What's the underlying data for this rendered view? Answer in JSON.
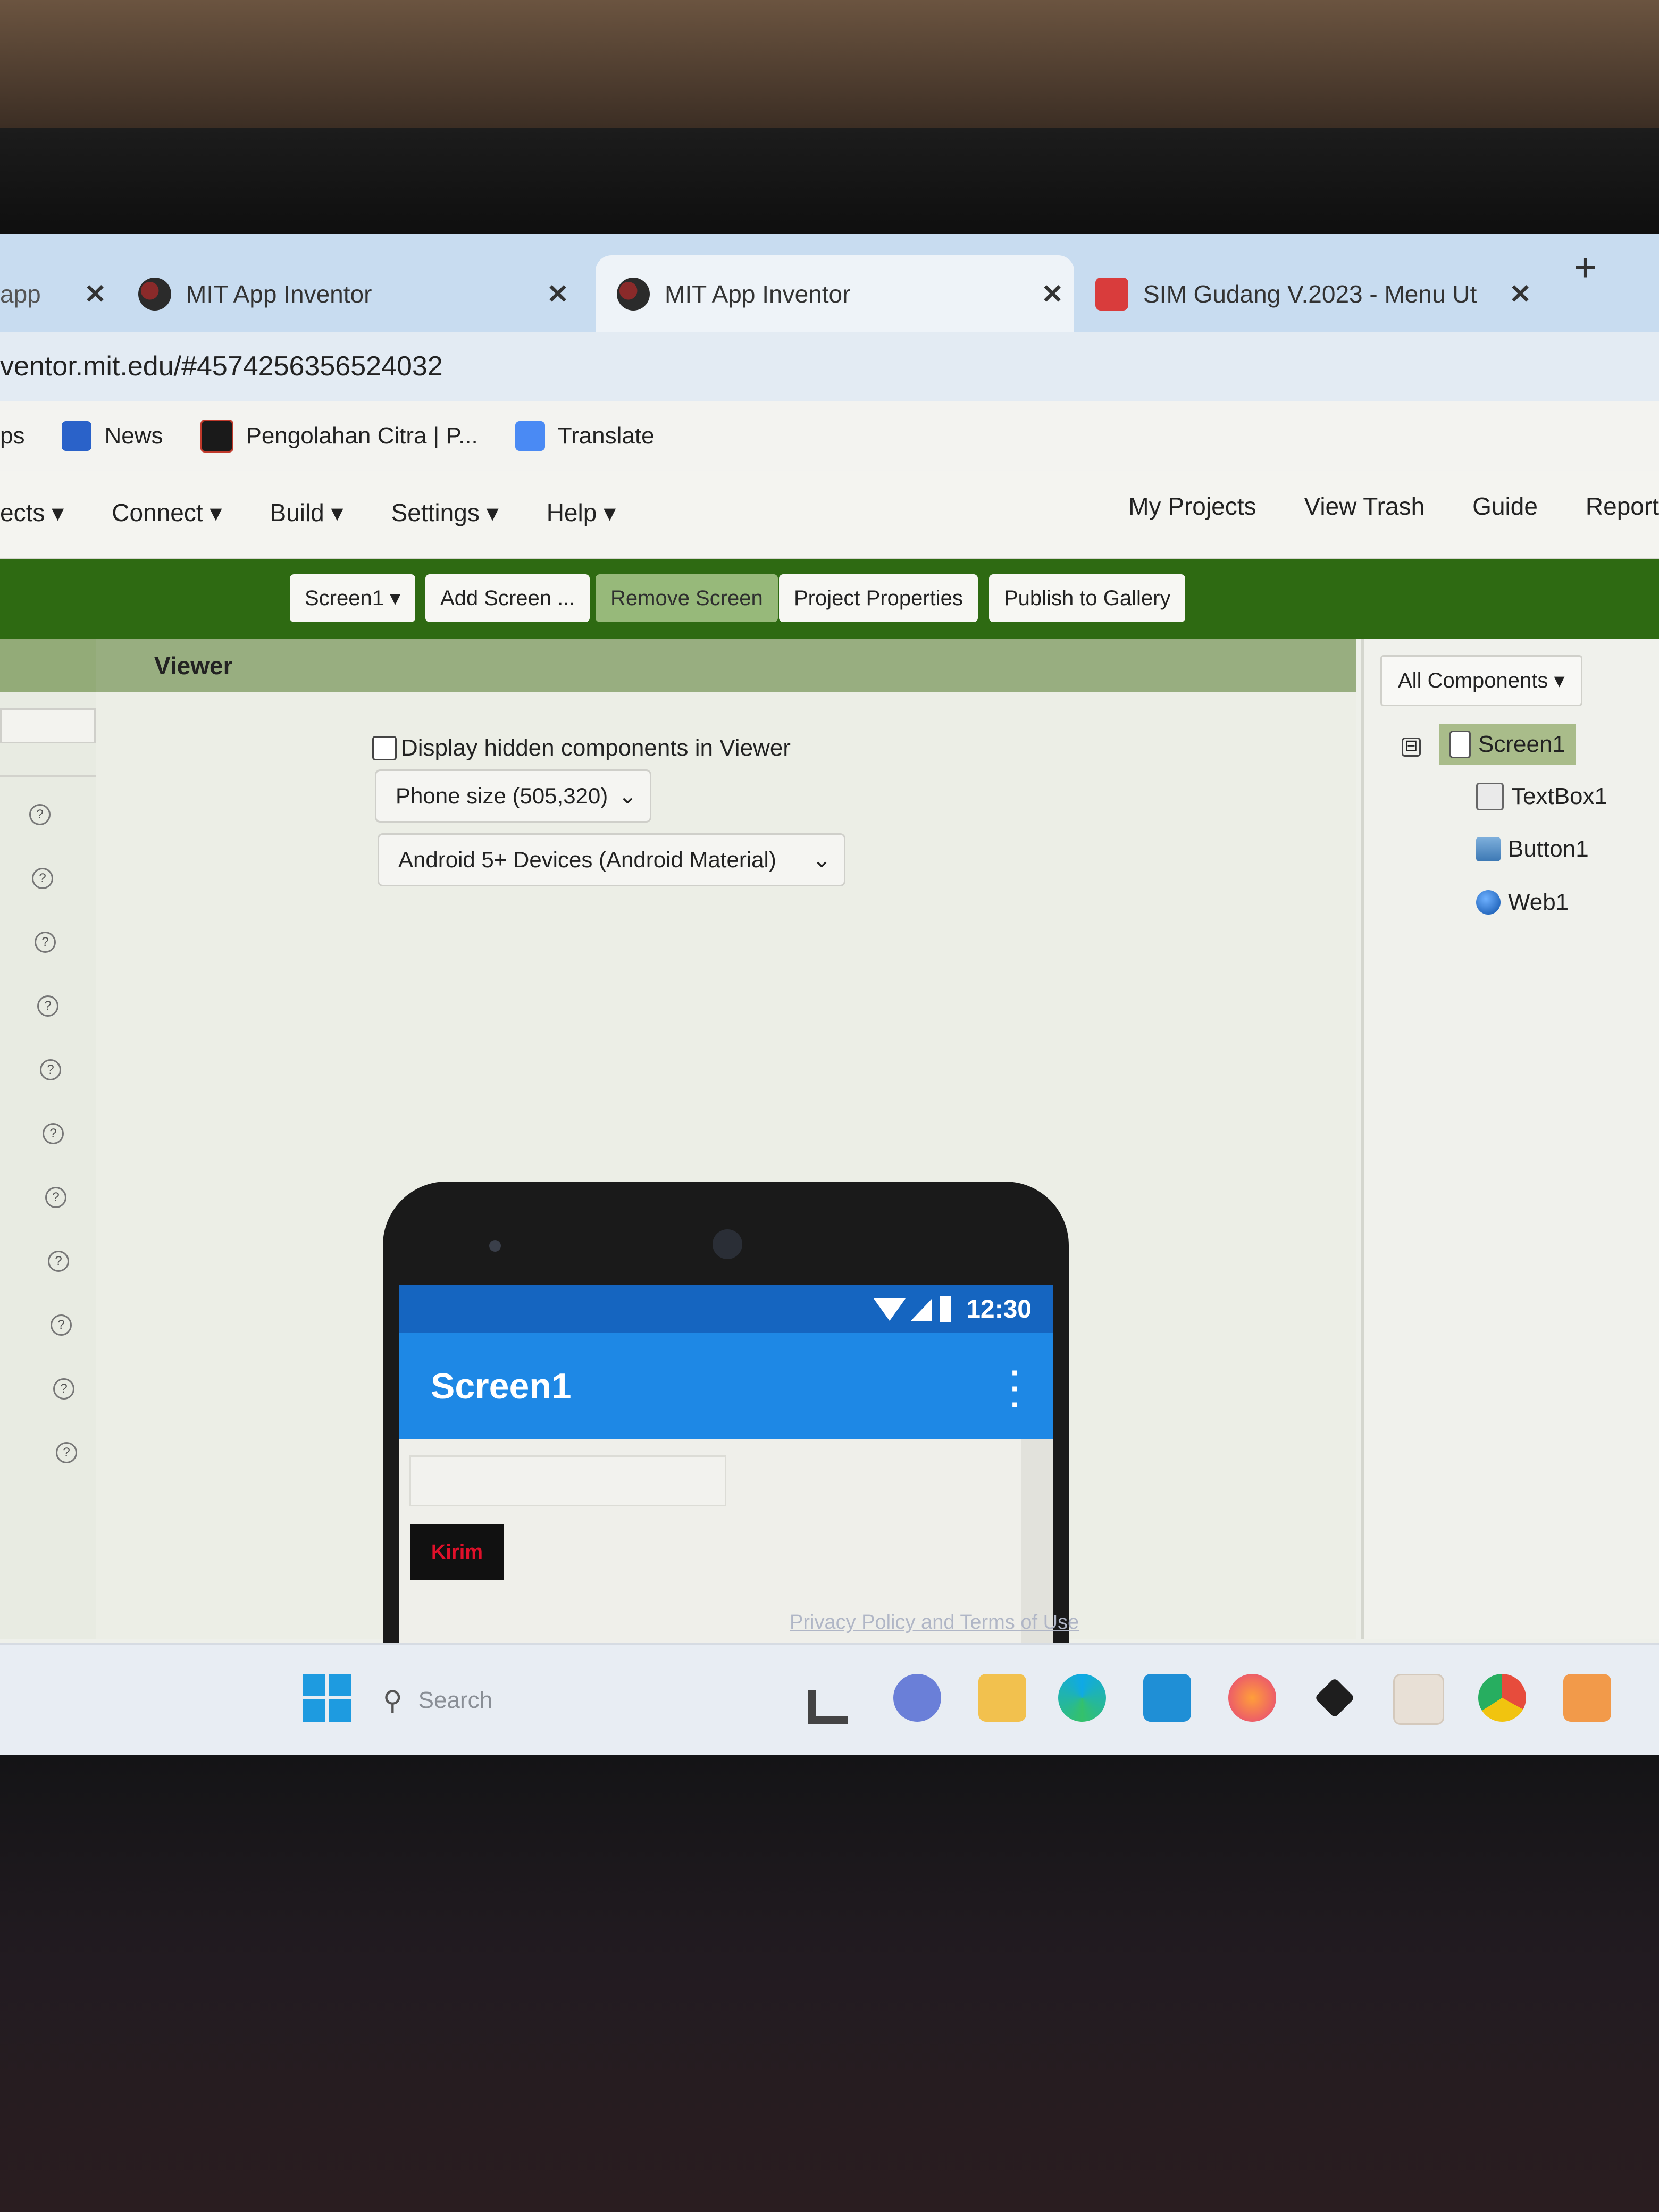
{
  "browser": {
    "tabs": [
      {
        "label": "app",
        "favicon": "app-icon",
        "active": false
      },
      {
        "label": "MIT App Inventor",
        "favicon": "mit-logo-icon",
        "active": false
      },
      {
        "label": "MIT App Inventor",
        "favicon": "mit-logo-icon",
        "active": true
      },
      {
        "label": "SIM Gudang V.2023 - Menu Ut",
        "favicon": "sim-gudang-icon",
        "active": false
      }
    ],
    "new_tab": "+",
    "close_glyph": "✕",
    "url": "ventor.mit.edu/#4574256356524032",
    "bookmarks": [
      {
        "label": "ps",
        "icon": "apps-icon"
      },
      {
        "label": "News",
        "icon": "news-icon"
      },
      {
        "label": "Pengolahan Citra | P...",
        "icon": "pengolahan-icon"
      },
      {
        "label": "Translate",
        "icon": "translate-icon"
      }
    ]
  },
  "appinventor": {
    "menu_left": [
      "ects ▾",
      "Connect ▾",
      "Build ▾",
      "Settings ▾",
      "Help ▾"
    ],
    "menu_right": [
      "My Projects",
      "View Trash",
      "Guide",
      "Report"
    ],
    "toolbar": {
      "screen_select": "Screen1 ▾",
      "add_screen": "Add Screen ...",
      "remove_screen": "Remove Screen",
      "project_properties": "Project Properties",
      "publish": "Publish to Gallery"
    },
    "viewer": {
      "title": "Viewer",
      "hidden_checkbox_label": "Display hidden components in Viewer",
      "phone_size": "Phone size (505,320)",
      "theme": "Android 5+ Devices (Android Material)"
    },
    "phone": {
      "time": "12:30",
      "screen_title": "Screen1",
      "button_label": "Kirim",
      "button_text_color": "#e0102a"
    },
    "components": {
      "filter": "All Components ▾",
      "tree_toggle": "⊟",
      "items": [
        {
          "label": "Screen1",
          "icon": "screen-icon",
          "selected": true
        },
        {
          "label": "TextBox1",
          "icon": "textbox-icon",
          "selected": false
        },
        {
          "label": "Button1",
          "icon": "button-icon",
          "selected": false
        },
        {
          "label": "Web1",
          "icon": "globe-icon",
          "selected": false
        }
      ]
    },
    "help_glyph": "?",
    "footer_link": "Privacy Policy and Terms of Use"
  },
  "taskbar": {
    "search_placeholder": "Search",
    "icons": [
      "windows-start-icon",
      "search-icon",
      "widgets-icon",
      "chat-icon",
      "file-explorer-icon",
      "edge-icon",
      "mail-icon",
      "firefox-icon",
      "dropbox-icon",
      "amazon-icon",
      "chrome-icon",
      "xampp-icon"
    ]
  },
  "colors": {
    "toolbar_green": "#2e6a12",
    "panel_header": "#98ae80",
    "status_bar": "#1565c0",
    "app_bar": "#1e88e5"
  }
}
